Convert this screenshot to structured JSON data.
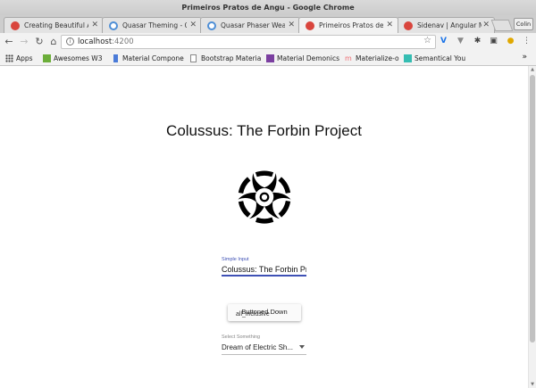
{
  "window": {
    "title": "Primeiros Pratos de Angu - Google Chrome"
  },
  "tabs": [
    {
      "label": "Creating Beautiful A",
      "favicon": "red-circle-icon",
      "active": false
    },
    {
      "label": "Quasar Theming - Q",
      "favicon": "quasar-icon",
      "active": false
    },
    {
      "label": "Quasar Phaser Weap",
      "favicon": "quasar-icon",
      "active": false
    },
    {
      "label": "Primeiros Pratos de A",
      "favicon": "angular-icon",
      "active": true
    },
    {
      "label": "Sidenav | Angular M",
      "favicon": "angular-icon",
      "active": false
    }
  ],
  "profile": {
    "label": "Colin"
  },
  "address": {
    "host": "localhost",
    "port": ":4200"
  },
  "bookmarks": [
    {
      "label": "Apps",
      "icon": "apps-grid-icon",
      "color": "#555555"
    },
    {
      "label": "Awesomes W3",
      "icon": "w3-icon",
      "color": "#6cae3a"
    },
    {
      "label": "Material Compone",
      "icon": "material-icon",
      "color": "#4a7bd8"
    },
    {
      "label": "Bootstrap Materia",
      "icon": "page-icon",
      "color": "#888888"
    },
    {
      "label": "Material Demonics",
      "icon": "demonics-icon",
      "color": "#7b3fa0"
    },
    {
      "label": "Materialize-o",
      "icon": "materialize-icon",
      "color": "#ee6e73"
    },
    {
      "label": "Semantical You",
      "icon": "semantic-icon",
      "color": "#35bdb2"
    }
  ],
  "page": {
    "title": "Colussus: The Forbin Project",
    "simple_input": {
      "label": "Simple Input",
      "value": "Colussus: The Forbin Pro"
    },
    "button": {
      "label": "Buttoned Down",
      "overlay_text": "all_inclusive"
    },
    "select": {
      "label": "Select Something",
      "value": "Dream of Electric Sh..."
    }
  },
  "colors": {
    "accent": "#3f51b5",
    "hazard": "#000000"
  }
}
